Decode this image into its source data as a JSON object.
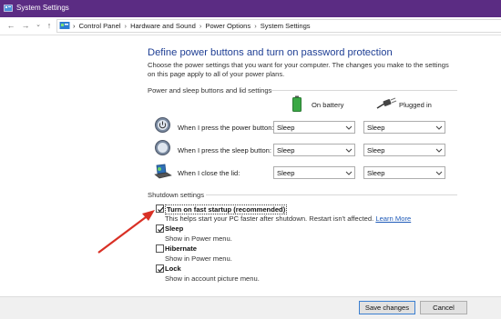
{
  "window": {
    "title": "System Settings"
  },
  "nav": {
    "breadcrumbs": [
      "Control Panel",
      "Hardware and Sound",
      "Power Options",
      "System Settings"
    ],
    "separator": "›",
    "back_glyph": "←",
    "forward_glyph": "→",
    "recent_glyph": "⌄",
    "up_glyph": "↑"
  },
  "page": {
    "heading": "Define power buttons and turn on password protection",
    "description": "Choose the power settings that you want for your computer. The changes you make to the settings on this page apply to all of your power plans."
  },
  "power_section": {
    "label": "Power and sleep buttons and lid settings",
    "columns": [
      "On battery",
      "Plugged in"
    ],
    "rows": [
      {
        "label": "When I press the power button:",
        "on_battery": "Sleep",
        "plugged_in": "Sleep",
        "icon": "power-button-icon"
      },
      {
        "label": "When I press the sleep button:",
        "on_battery": "Sleep",
        "plugged_in": "Sleep",
        "icon": "sleep-button-icon"
      },
      {
        "label": "When I close the lid:",
        "on_battery": "Sleep",
        "plugged_in": "Sleep",
        "icon": "laptop-lid-icon"
      }
    ]
  },
  "shutdown_section": {
    "label": "Shutdown settings",
    "options": [
      {
        "label": "Turn on fast startup (recommended)",
        "help": "This helps start your PC faster after shutdown. Restart isn't affected.",
        "link": "Learn More",
        "checked": true
      },
      {
        "label": "Sleep",
        "help": "Show in Power menu.",
        "checked": true
      },
      {
        "label": "Hibernate",
        "help": "Show in Power menu.",
        "checked": false
      },
      {
        "label": "Lock",
        "help": "Show in account picture menu.",
        "checked": true
      }
    ]
  },
  "footer": {
    "save_label": "Save changes",
    "cancel_label": "Cancel"
  },
  "colors": {
    "titlebar": "#5b2c83",
    "heading": "#1e3e94",
    "link": "#1e5ab8",
    "annotation_arrow": "#d93025"
  }
}
